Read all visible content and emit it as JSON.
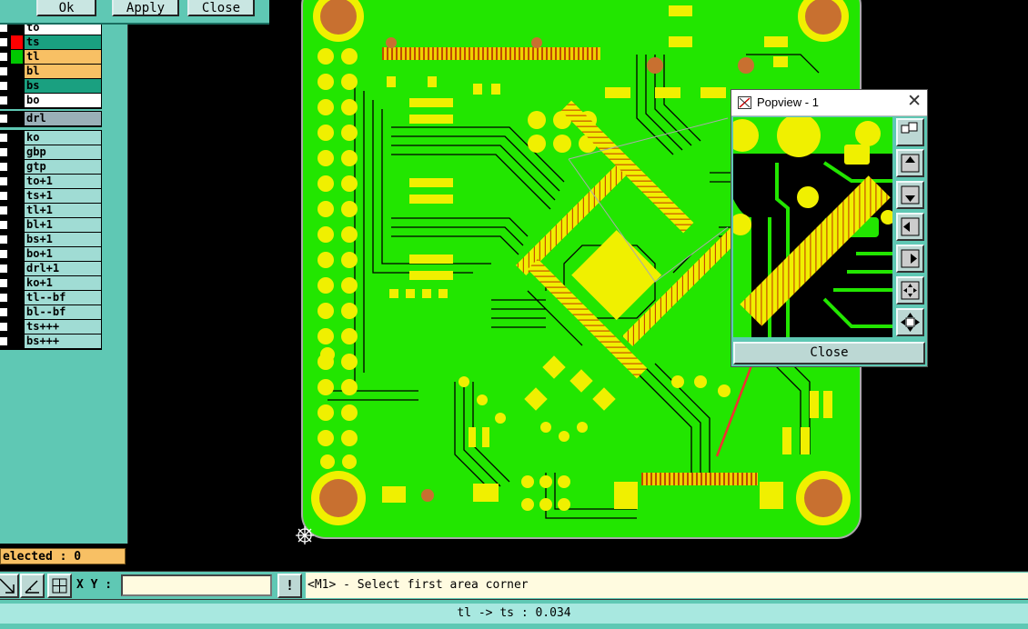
{
  "top_dialog": {
    "ok": "Ok",
    "apply": "Apply",
    "close": "Close"
  },
  "layers_group1": [
    {
      "name": "to",
      "swatch": "#000000",
      "bg": "#ffffff"
    },
    {
      "name": "ts",
      "swatch": "#ff0000",
      "bg": "#1aa080"
    },
    {
      "name": "tl",
      "swatch": "#00c800",
      "bg": "#f8c064"
    },
    {
      "name": "bl",
      "swatch": "#000000",
      "bg": "#f8c064"
    },
    {
      "name": "bs",
      "swatch": "#000000",
      "bg": "#1aa080"
    },
    {
      "name": "bo",
      "swatch": "#000000",
      "bg": "#ffffff"
    }
  ],
  "layers_group2": [
    {
      "name": "drl",
      "swatch": "#000000",
      "bg": "#9ab0b8"
    }
  ],
  "layers_group3": [
    {
      "name": "ko"
    },
    {
      "name": "gbp"
    },
    {
      "name": "gtp"
    },
    {
      "name": "to+1"
    },
    {
      "name": "ts+1"
    },
    {
      "name": "tl+1"
    },
    {
      "name": "bl+1"
    },
    {
      "name": "bs+1"
    },
    {
      "name": "bo+1"
    },
    {
      "name": "drl+1"
    },
    {
      "name": "ko+1"
    },
    {
      "name": "tl--bf"
    },
    {
      "name": "bl--bf"
    },
    {
      "name": "ts+++"
    },
    {
      "name": "bs+++"
    }
  ],
  "selected_label": "elected : 0",
  "popview": {
    "title": "Popview - 1",
    "close_label": "Close"
  },
  "cmd": {
    "xy_label": "X Y :",
    "xy_value": "",
    "msg_btn": "!",
    "prompt": "<M1> - Select first area corner"
  },
  "status": "tl -> ts : 0.034",
  "colors": {
    "board": "#22e600",
    "pad": "#f0f000",
    "copper_dark": "#c06020",
    "panel": "#5fc8b4",
    "arrow": "#f03030"
  }
}
